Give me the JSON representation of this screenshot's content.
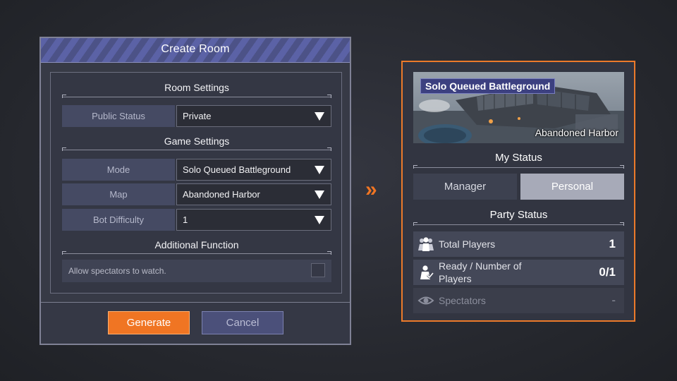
{
  "create_room": {
    "title": "Create Room",
    "room_settings": {
      "heading": "Room Settings",
      "public_status": {
        "label": "Public Status",
        "value": "Private"
      }
    },
    "game_settings": {
      "heading": "Game Settings",
      "mode": {
        "label": "Mode",
        "value": "Solo Queued Battleground"
      },
      "map": {
        "label": "Map",
        "value": "Abandoned Harbor"
      },
      "bot_difficulty": {
        "label": "Bot Difficulty",
        "value": "1"
      }
    },
    "additional_function": {
      "heading": "Additional Function",
      "allow_spectators_label": "Allow spectators to watch.",
      "allow_spectators_checked": false
    },
    "buttons": {
      "generate": "Generate",
      "cancel": "Cancel"
    }
  },
  "arrow_glyph": "»",
  "status_panel": {
    "mode_tag": "Solo Queued Battleground",
    "map_name": "Abandoned Harbor",
    "my_status": {
      "heading": "My Status",
      "tabs": [
        {
          "label": "Manager",
          "selected": false
        },
        {
          "label": "Personal",
          "selected": true
        }
      ]
    },
    "party_status": {
      "heading": "Party Status",
      "rows": [
        {
          "icon": "players-group-icon",
          "label": "Total Players",
          "value": "1"
        },
        {
          "icon": "ready-player-icon",
          "label": "Ready / Number of Players",
          "value": "0/1"
        },
        {
          "icon": "eye-icon",
          "label": "Spectators",
          "value": "-"
        }
      ]
    }
  },
  "colors": {
    "accent_orange": "#f07523",
    "header_blue": "#4c5287",
    "selected_tab": "#a7aab8"
  }
}
